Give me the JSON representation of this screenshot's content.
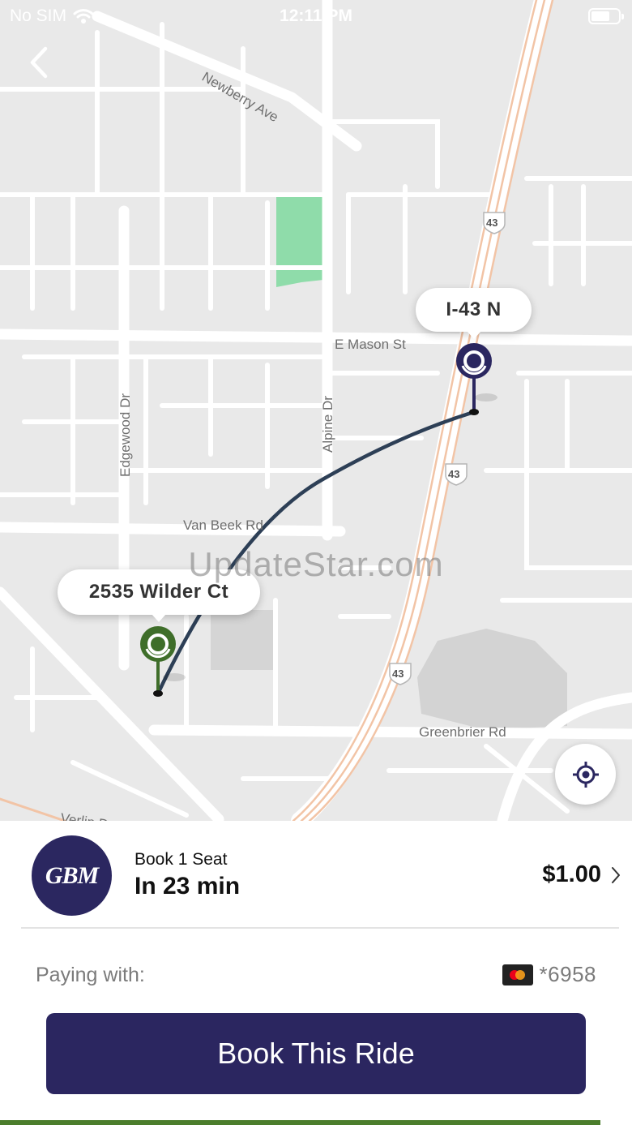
{
  "status_bar": {
    "carrier": "No SIM",
    "time": "12:11 PM"
  },
  "map": {
    "street_labels": {
      "newberry": "Newberry Ave",
      "mason": "E Mason St",
      "edgewood": "Edgewood Dr",
      "alpine": "Alpine Dr",
      "van_beek": "Van Beek Rd",
      "greenbrier": "Greenbrier Rd",
      "verlin": "Verlin D"
    },
    "highway_shield": "43",
    "destination_label": "I-43 N",
    "origin_label": "2535 Wilder Ct",
    "watermark": "UpdateStar.com",
    "colors": {
      "route_dest": "#2b2760",
      "route_origin": "#3f6e2a",
      "park": "#8fdcaa",
      "highway": "#f2c4a6"
    }
  },
  "ride": {
    "logo_text": "GBM",
    "label": "Book 1 Seat",
    "eta": "In 23 min",
    "price": "$1.00"
  },
  "payment": {
    "label": "Paying with:",
    "card": "*6958"
  },
  "book_button": "Book This Ride"
}
